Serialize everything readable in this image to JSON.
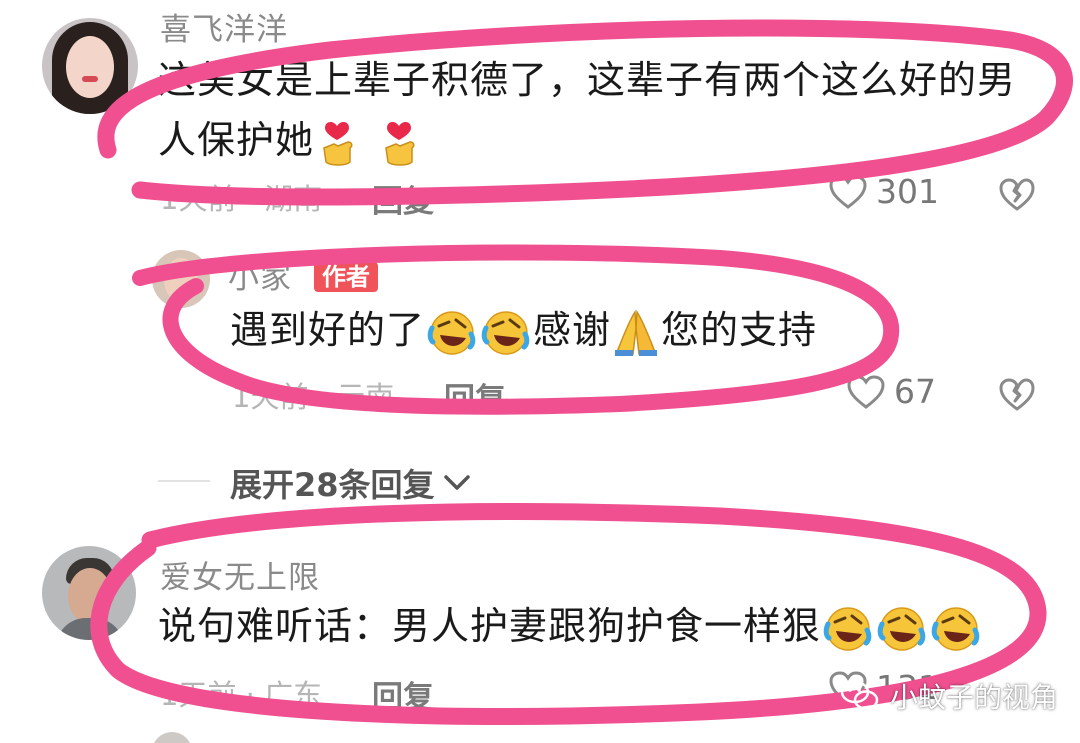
{
  "comments": [
    {
      "username": "喜飞洋洋",
      "text": "这美女是上辈子积德了，这辈子有两个这么好的男人保护她",
      "meta": "1天前 · 湖南",
      "reply_label": "回复",
      "likes": "301"
    },
    {
      "username": "小家",
      "badge": "作者",
      "text": "遇到好的了",
      "text_mid": "感谢",
      "text_end": "您的支持",
      "meta": "1天前 · 云南",
      "reply_label": "回复",
      "likes": "67"
    },
    {
      "username": "爱女无上限",
      "text": "说句难听话：男人护妻跟狗护食一样狠",
      "meta": "1天前 · 广东",
      "reply_label": "回复",
      "likes": "131"
    }
  ],
  "expand_replies": "展开28条回复",
  "watermark": "小蚊子的视角",
  "colors": {
    "annotation": "#f0508f",
    "badge": "#f0535a"
  },
  "icons": {
    "like": "heart-outline-icon",
    "dislike": "broken-heart-icon",
    "expand": "chevron-down-icon",
    "watermark": "wechat-logo-icon"
  }
}
